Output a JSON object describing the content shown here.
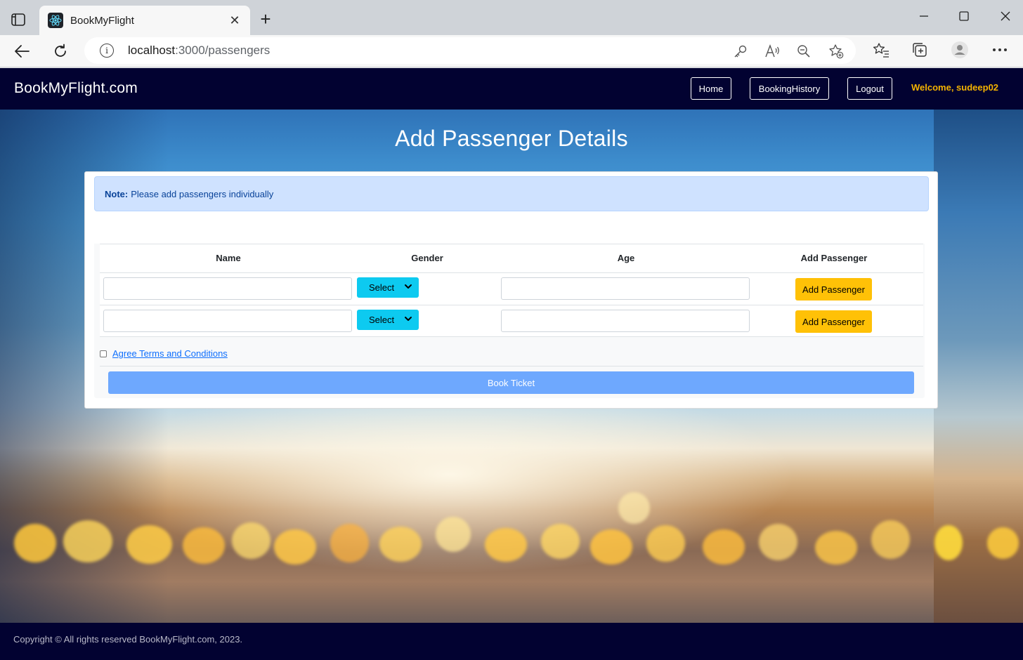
{
  "browser": {
    "tab_title": "BookMyFlight",
    "tab_close": "✕",
    "new_tab": "+",
    "url_host": "localhost",
    "url_path": ":3000/passengers"
  },
  "navbar": {
    "brand": "BookMyFlight.com",
    "links": [
      {
        "label": "Home"
      },
      {
        "label": "BookingHistory"
      },
      {
        "label": "Logout"
      }
    ],
    "welcome": "Welcome, sudeep02"
  },
  "main": {
    "title": "Add Passenger Details",
    "note_label": "Note:",
    "note_text": "Please add passengers individually",
    "table": {
      "headers": [
        "Name",
        "Gender",
        "Age",
        "Add Passenger"
      ],
      "rows": [
        {
          "name": "",
          "gender": "Select",
          "age": "",
          "action": "Add Passenger"
        },
        {
          "name": "",
          "gender": "Select",
          "age": "",
          "action": "Add Passenger"
        }
      ]
    },
    "terms_label": "Agree Terms and Conditions",
    "book_button": "Book Ticket"
  },
  "footer": {
    "text": "Copyright © All rights reserved BookMyFlight.com, 2023."
  },
  "colors": {
    "navbar_bg": "#020231",
    "welcome": "#f5b300",
    "note_bg": "#cfe2ff",
    "select_bg": "#0dcaf0",
    "add_button": "#ffc107",
    "book_button": "#6ea8fe"
  },
  "icons": [
    "tab-actions-icon",
    "react-favicon-icon",
    "close-icon",
    "plus-icon",
    "minimize-icon",
    "maximize-icon",
    "window-close-icon",
    "back-arrow-icon",
    "refresh-icon",
    "info-icon",
    "key-icon",
    "read-aloud-icon",
    "zoom-out-icon",
    "add-favorite-icon",
    "favorites-icon",
    "collections-icon",
    "profile-icon",
    "more-icon",
    "chevron-down-icon"
  ]
}
